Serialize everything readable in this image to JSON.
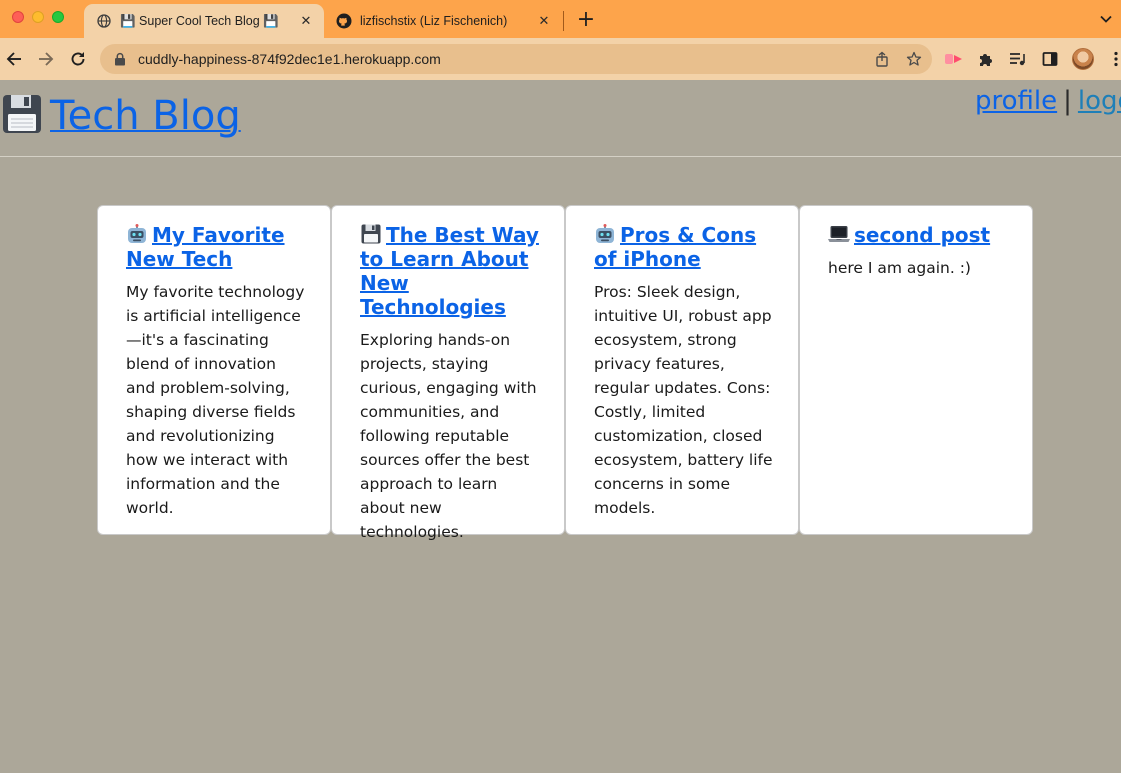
{
  "browser": {
    "tabs": [
      {
        "title": "💾 Super Cool Tech Blog 💾",
        "favicon": "globe-icon",
        "active": true
      },
      {
        "title": "lizfischstix (Liz Fischenich)",
        "favicon": "github-icon",
        "active": false
      }
    ],
    "new_tab": "+",
    "close_glyph": "✕",
    "url": "cuddly-happiness-874f92dec1e1.herokuapp.com",
    "colors": {
      "tabbar": "#fda44b",
      "toolbar": "#f3d2a8",
      "omnibox": "#e8bf8d"
    }
  },
  "site": {
    "title": "Tech Blog",
    "title_icon": "floppy-disk-icon",
    "nav": {
      "profile": "profile",
      "separator": "|",
      "logout": "logout"
    },
    "colors": {
      "background": "#aca799",
      "link": "#0b63e6"
    }
  },
  "posts": [
    {
      "icon": "robot-icon",
      "title": "My Favorite New Tech",
      "body": "My favorite technology is artificial intelligence—it's a fascinating blend of innovation and problem-solving, shaping diverse fields and revolutionizing how we interact with information and the world."
    },
    {
      "icon": "floppy-disk-icon",
      "title": "The Best Way to Learn About New Technologies",
      "body": "Exploring hands-on projects, staying curious, engaging with communities, and following reputable sources offer the best approach to learn about new technologies."
    },
    {
      "icon": "robot-icon",
      "title": "Pros & Cons of iPhone",
      "body": "Pros: Sleek design, intuitive UI, robust app ecosystem, strong privacy features, regular updates. Cons: Costly, limited customization, closed ecosystem, battery life concerns in some models."
    },
    {
      "icon": "laptop-icon",
      "title": "second post",
      "body": "here I am again. :)"
    }
  ]
}
